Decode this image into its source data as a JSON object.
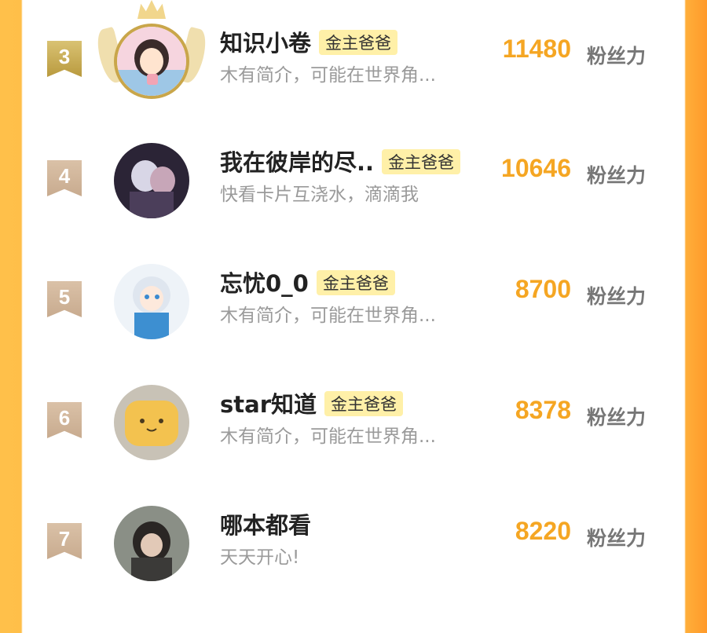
{
  "rows": [
    {
      "rank": "3",
      "name": "知识小卷",
      "badge": "金主爸爸",
      "bio": "木有简介，可能在世界角...",
      "score": "11480",
      "unit": "粉丝力",
      "avatar": "avatar-girl-illustration",
      "style": "gold"
    },
    {
      "rank": "4",
      "name": "我在彼岸的尽..",
      "badge": "金主爸爸",
      "bio": "快看卡片互浇水，滴滴我",
      "score": "10646",
      "unit": "粉丝力",
      "avatar": "avatar-anime-couple",
      "style": "plain"
    },
    {
      "rank": "5",
      "name": "忘忧0_0",
      "badge": "金主爸爸",
      "bio": "木有简介，可能在世界角...",
      "score": "8700",
      "unit": "粉丝力",
      "avatar": "avatar-anime-shark-girl",
      "style": "plain"
    },
    {
      "rank": "6",
      "name": "star知道",
      "badge": "金主爸爸",
      "bio": "木有简介，可能在世界角...",
      "score": "8378",
      "unit": "粉丝力",
      "avatar": "avatar-toast-cat",
      "style": "plain"
    },
    {
      "rank": "7",
      "name": "哪本都看",
      "badge": "",
      "bio": "天天开心!",
      "score": "8220",
      "unit": "粉丝力",
      "avatar": "avatar-person-scarf",
      "style": "plain"
    }
  ],
  "colors": {
    "accent": "#f5a623",
    "badge_bg": "#fff0a8",
    "frame": "#ffb43f"
  }
}
